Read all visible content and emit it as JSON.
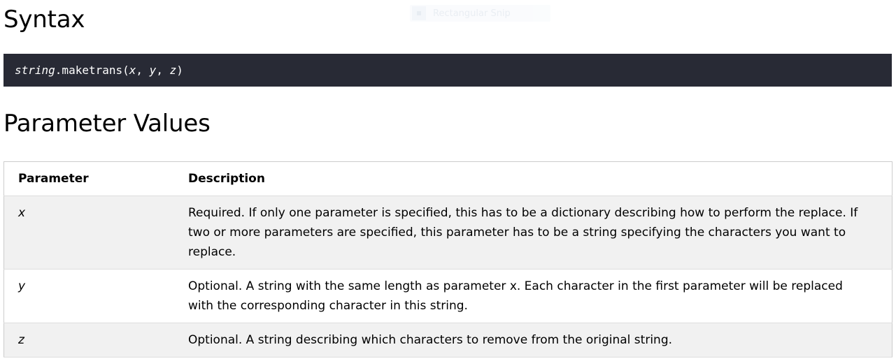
{
  "headings": {
    "syntax": "Syntax",
    "parameter_values": "Parameter Values"
  },
  "overlay": {
    "label": "Rectangular Snip",
    "icon": "snip-icon"
  },
  "syntax": {
    "object": "string",
    "method": ".maketrans(",
    "arg_x": "x",
    "sep1": ", ",
    "arg_y": "y",
    "sep2": ", ",
    "arg_z": "z",
    "close": ")"
  },
  "table": {
    "headers": [
      "Parameter",
      "Description"
    ],
    "rows": [
      {
        "name": "x",
        "description": "Required. If only one parameter is specified, this has to be a dictionary describing how to perform the replace. If two or more parameters are specified, this parameter has to be a string specifying the characters you want to replace."
      },
      {
        "name": "y",
        "description": "Optional. A string with the same length as parameter x. Each character in the first parameter will be replaced with the corresponding character in this string."
      },
      {
        "name": "z",
        "description": "Optional. A string describing which characters to remove from the original string."
      }
    ]
  },
  "colors": {
    "code_background": "#282a35",
    "code_text": "#ffffff",
    "row_alt": "#f1f1f1",
    "table_border": "#cccccc"
  }
}
